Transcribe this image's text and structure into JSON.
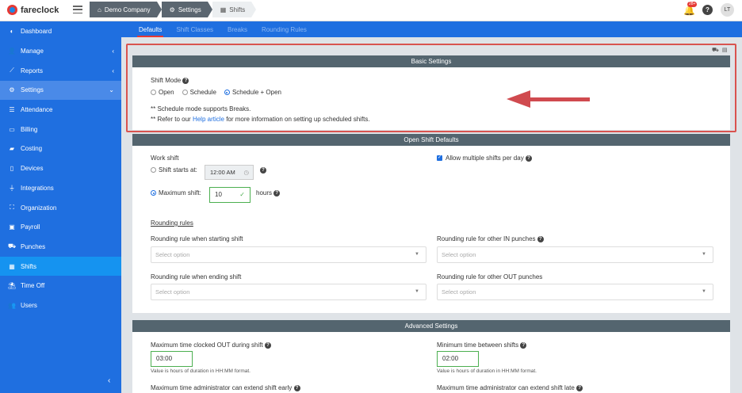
{
  "brand": {
    "name": "fareclock"
  },
  "breadcrumbs": [
    {
      "label": "Demo Company",
      "icon": "home-icon"
    },
    {
      "label": "Settings",
      "icon": "gear-icon"
    },
    {
      "label": "Shifts",
      "icon": "calendar-icon"
    }
  ],
  "notifications": {
    "count": "28+"
  },
  "user": {
    "initials": "LT"
  },
  "sidebar": {
    "items": [
      {
        "label": "Dashboard",
        "icon": "dashboard-icon"
      },
      {
        "label": "Manage",
        "icon": "person-icon",
        "chevron": "‹"
      },
      {
        "label": "Reports",
        "icon": "chart-icon",
        "chevron": "‹"
      },
      {
        "label": "Settings",
        "icon": "gear-icon",
        "chevron": "⌄"
      },
      {
        "label": "Attendance",
        "icon": "list-icon"
      },
      {
        "label": "Billing",
        "icon": "card-icon"
      },
      {
        "label": "Costing",
        "icon": "folder-icon"
      },
      {
        "label": "Devices",
        "icon": "tablet-icon"
      },
      {
        "label": "Integrations",
        "icon": "plug-icon"
      },
      {
        "label": "Organization",
        "icon": "org-icon"
      },
      {
        "label": "Payroll",
        "icon": "money-icon"
      },
      {
        "label": "Punches",
        "icon": "truck-icon"
      },
      {
        "label": "Shifts",
        "icon": "calendar-icon"
      },
      {
        "label": "Time Off",
        "icon": "beach-icon"
      },
      {
        "label": "Users",
        "icon": "users-icon"
      }
    ],
    "collapse": "‹"
  },
  "tabs": [
    "Defaults",
    "Shift Classes",
    "Breaks",
    "Rounding Rules"
  ],
  "basic": {
    "title": "Basic Settings",
    "shift_mode_label": "Shift Mode",
    "options": [
      "Open",
      "Schedule",
      "Schedule + Open"
    ],
    "note1": "** Schedule mode supports Breaks.",
    "note2_prefix": "** Refer to our",
    "note2_link": "Help article",
    "note2_suffix": "for more information on setting up scheduled shifts."
  },
  "open_shift": {
    "title": "Open Shift Defaults",
    "work_shift_label": "Work shift",
    "starts_at_label": "Shift starts at:",
    "starts_at_value": "12:00 AM",
    "max_shift_label": "Maximum shift:",
    "max_shift_value": "10",
    "hours_label": "hours",
    "allow_multiple_label": "Allow multiple shifts per day",
    "rounding_rules_label": "Rounding rules",
    "rule_start_label": "Rounding rule when starting shift",
    "rule_in_label": "Rounding rule for other IN punches",
    "rule_end_label": "Rounding rule when ending shift",
    "rule_out_label": "Rounding rule for other OUT punches",
    "select_placeholder": "Select option"
  },
  "advanced": {
    "title": "Advanced Settings",
    "max_out_label": "Maximum time clocked OUT during shift",
    "max_out_value": "03:00",
    "min_between_label": "Minimum time between shifts",
    "min_between_value": "02:00",
    "hint": "Value is hours of duration in HH:MM format.",
    "extend_early_label": "Maximum time administrator can extend shift early",
    "extend_late_label": "Maximum time administrator can extend shift late"
  },
  "colors": {
    "sidebar": "#1f6fe0",
    "panel_header": "#54656f",
    "highlight": "#d9534f"
  }
}
